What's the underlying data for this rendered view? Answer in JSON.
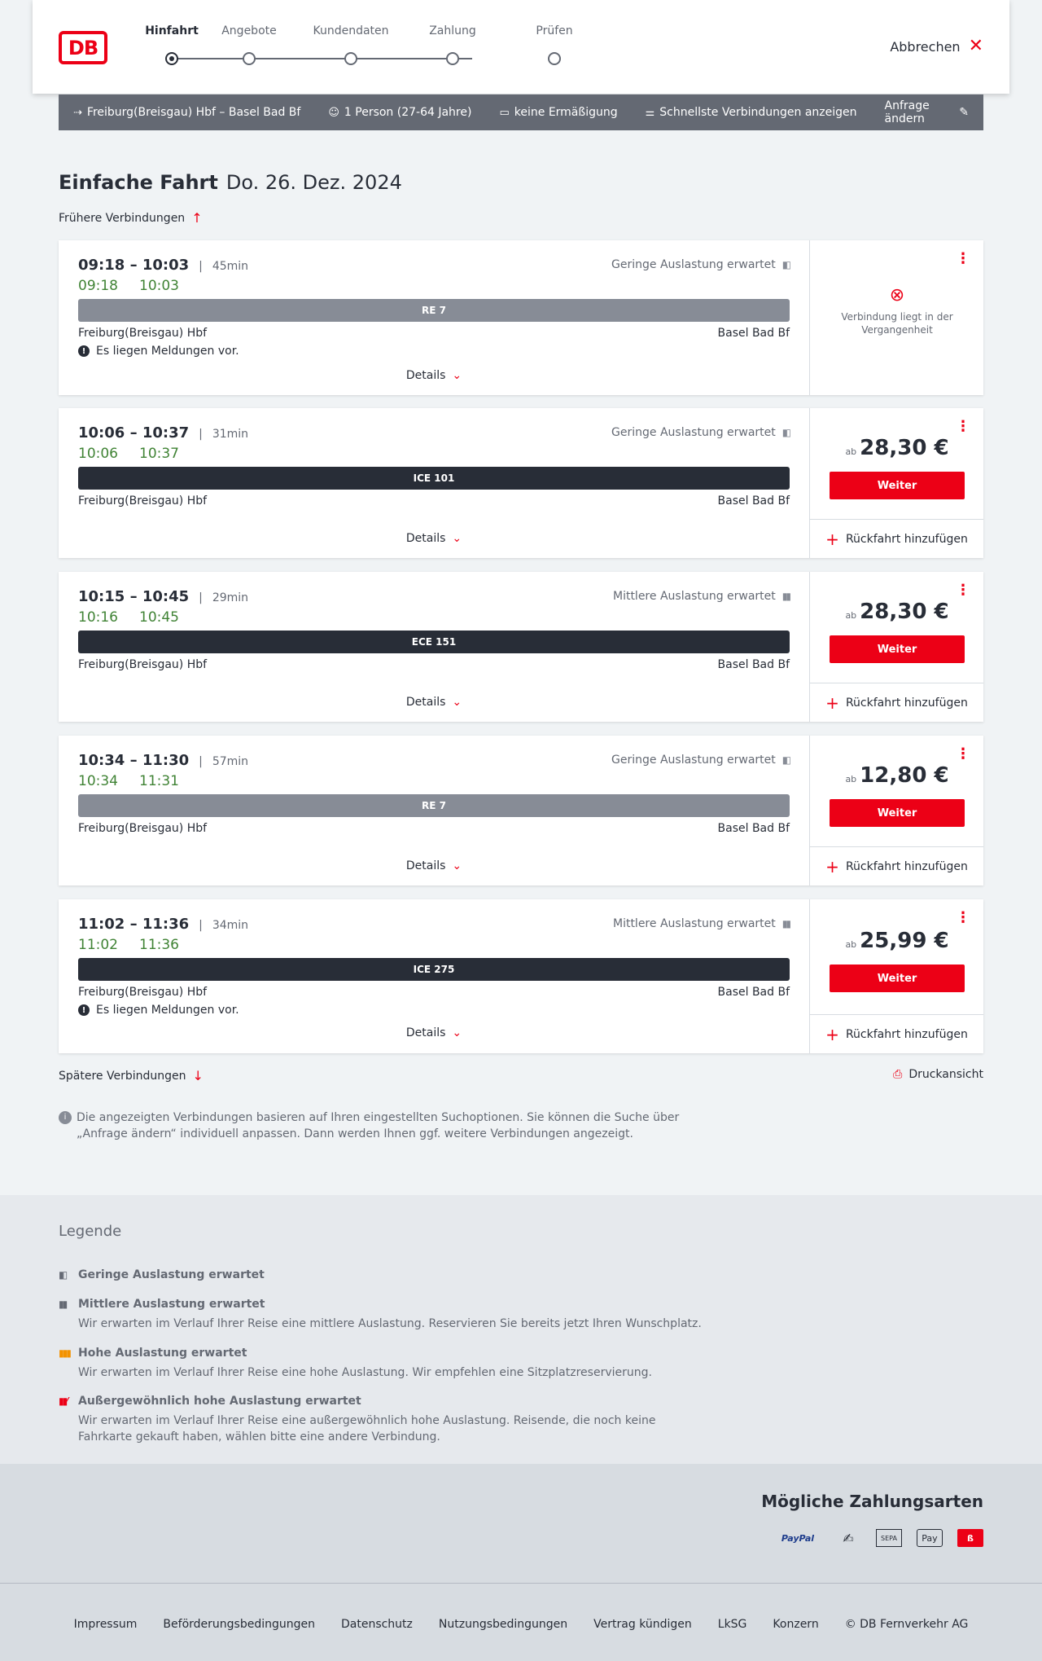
{
  "header": {
    "logo": "DB",
    "steps": [
      {
        "label": "Hinfahrt",
        "active": true
      },
      {
        "label": "Angebote",
        "active": false
      },
      {
        "label": "Kundendaten",
        "active": false
      },
      {
        "label": "Zahlung",
        "active": false
      },
      {
        "label": "Prüfen",
        "active": false
      }
    ],
    "cancel_label": "Abbrechen"
  },
  "query": {
    "route": "Freiburg(Breisgau) Hbf – Basel Bad Bf",
    "persons": "1 Person (27-64 Jahre)",
    "discount": "keine Ermäßigung",
    "fastest": "Schnellste Verbindungen anzeigen",
    "edit": "Anfrage ändern"
  },
  "page": {
    "title_bold": "Einfache Fahrt",
    "title_date": "Do. 26. Dez. 2024",
    "earlier": "Frühere Verbindungen",
    "later": "Spätere Verbindungen",
    "print": "Druckansicht",
    "info": "Die angezeigten Verbindungen basieren auf Ihren eingestellten Suchoptionen. Sie können die Suche über „Anfrage ändern“ individuell anpassen. Dann werden Ihnen ggf. weitere Verbindungen angezeigt."
  },
  "connections": [
    {
      "time": "09:18 – 10:03",
      "duration": "45min",
      "rt_dep": "09:18",
      "rt_arr": "10:03",
      "load": "Geringe Auslastung erwartet",
      "train": "RE 7",
      "from": "Freiburg(Breisgau) Hbf",
      "to": "Basel Bad Bf",
      "message": "Es liegen Meldungen vor.",
      "details": "Details",
      "past": "Verbindung liegt in der Vergangenheit"
    },
    {
      "time": "10:06 – 10:37",
      "duration": "31min",
      "rt_dep": "10:06",
      "rt_arr": "10:37",
      "load": "Geringe Auslastung erwartet",
      "train": "ICE 101",
      "from": "Freiburg(Breisgau) Hbf",
      "to": "Basel Bad Bf",
      "details": "Details",
      "price_prefix": "ab",
      "price": "28,30 €",
      "button": "Weiter",
      "return": "Rückfahrt hinzufügen"
    },
    {
      "time": "10:15 – 10:45",
      "duration": "29min",
      "rt_dep": "10:16",
      "rt_arr": "10:45",
      "load": "Mittlere Auslastung erwartet",
      "train": "ECE 151",
      "from": "Freiburg(Breisgau) Hbf",
      "to": "Basel Bad Bf",
      "details": "Details",
      "price_prefix": "ab",
      "price": "28,30 €",
      "button": "Weiter",
      "return": "Rückfahrt hinzufügen"
    },
    {
      "time": "10:34 – 11:30",
      "duration": "57min",
      "rt_dep": "10:34",
      "rt_arr": "11:31",
      "load": "Geringe Auslastung erwartet",
      "train": "RE 7",
      "from": "Freiburg(Breisgau) Hbf",
      "to": "Basel Bad Bf",
      "details": "Details",
      "price_prefix": "ab",
      "price": "12,80 €",
      "button": "Weiter",
      "return": "Rückfahrt hinzufügen"
    },
    {
      "time": "11:02 – 11:36",
      "duration": "34min",
      "rt_dep": "11:02",
      "rt_arr": "11:36",
      "load": "Mittlere Auslastung erwartet",
      "train": "ICE 275",
      "from": "Freiburg(Breisgau) Hbf",
      "to": "Basel Bad Bf",
      "message": "Es liegen Meldungen vor.",
      "details": "Details",
      "price_prefix": "ab",
      "price": "25,99 €",
      "button": "Weiter",
      "return": "Rückfahrt hinzufügen"
    }
  ],
  "legend": {
    "title": "Legende",
    "items": [
      {
        "title": "Geringe Auslastung erwartet",
        "desc": ""
      },
      {
        "title": "Mittlere Auslastung erwartet",
        "desc": "Wir erwarten im Verlauf Ihrer Reise eine mittlere Auslastung. Reservieren Sie bereits jetzt Ihren Wunschplatz."
      },
      {
        "title": "Hohe Auslastung erwartet",
        "desc": "Wir erwarten im Verlauf Ihrer Reise eine hohe Auslastung. Wir empfehlen eine Sitzplatzreservierung."
      },
      {
        "title": "Außergewöhnlich hohe Auslastung erwartet",
        "desc": "Wir erwarten im Verlauf Ihrer Reise eine außergewöhnlich hohe Auslastung. Reisende, die noch keine Fahrkarte gekauft haben, wählen bitte eine andere Verbindung."
      }
    ]
  },
  "payment": {
    "title": "Mögliche Zahlungsarten",
    "paypal": "PayPal",
    "sepa": "SEPA",
    "applepay": "Pay"
  },
  "footer": {
    "links": [
      "Impressum",
      "Beförderungsbedingungen",
      "Datenschutz",
      "Nutzungsbedingungen",
      "Vertrag kündigen",
      "LkSG",
      "Konzern",
      "© DB Fernverkehr AG"
    ]
  },
  "colors": {
    "accent": "#ec0016",
    "realtime": "#408335",
    "dark": "#282d37",
    "grey_bar": "#878c96"
  }
}
